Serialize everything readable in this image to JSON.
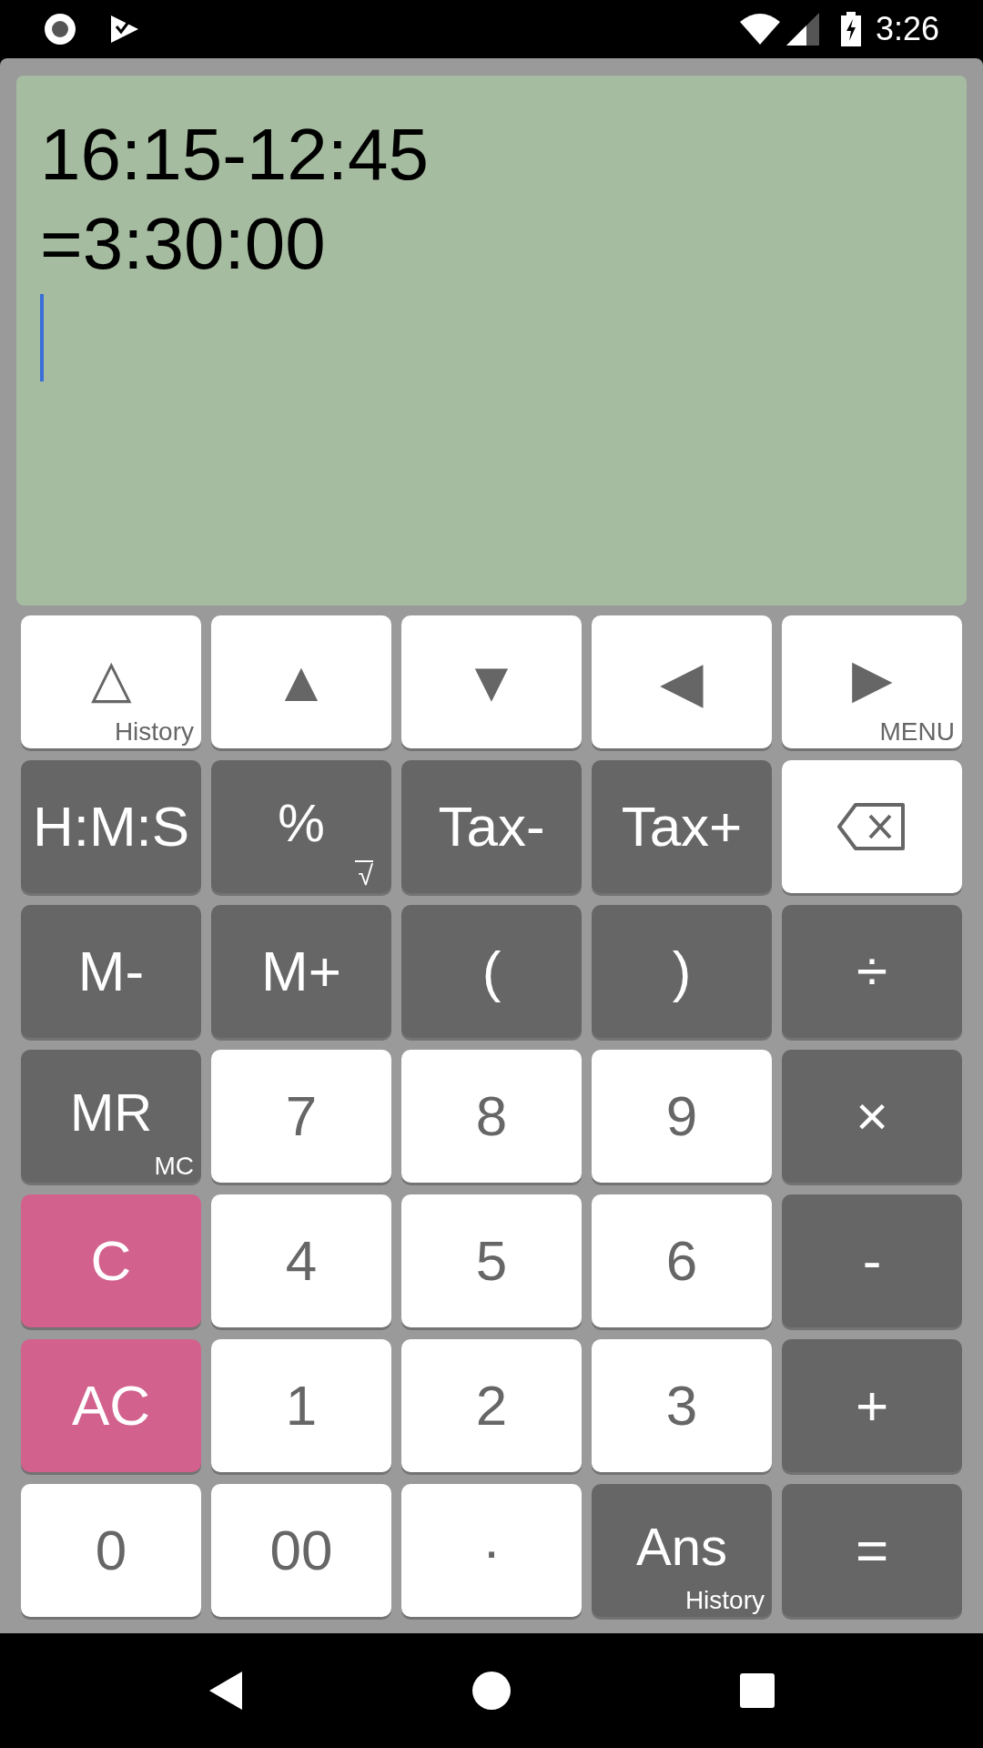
{
  "status_bar": {
    "time": "3:26"
  },
  "display": {
    "lines": [
      "16:15-12:45",
      "=3:30:00"
    ],
    "cursor": true
  },
  "keys": [
    {
      "label": "△",
      "sub": "History",
      "kind": "light"
    },
    {
      "label": "▲",
      "kind": "light"
    },
    {
      "label": "▼",
      "kind": "light"
    },
    {
      "label": "◀",
      "kind": "light"
    },
    {
      "label": "▶",
      "sub": "MENU",
      "kind": "light"
    },
    {
      "label": "H:M:S",
      "kind": "dark"
    },
    {
      "label": "%",
      "sub": "√",
      "kind": "dark"
    },
    {
      "label": "Tax-",
      "kind": "dark"
    },
    {
      "label": "Tax+",
      "kind": "dark"
    },
    {
      "kind": "backspace"
    },
    {
      "label": "M-",
      "kind": "dark"
    },
    {
      "label": "M+",
      "kind": "dark"
    },
    {
      "label": "(",
      "kind": "dark"
    },
    {
      "label": ")",
      "kind": "dark"
    },
    {
      "label": "÷",
      "kind": "dark"
    },
    {
      "label": "MR",
      "sub": "MC",
      "kind": "dark"
    },
    {
      "label": "7",
      "kind": "light"
    },
    {
      "label": "8",
      "kind": "light"
    },
    {
      "label": "9",
      "kind": "light"
    },
    {
      "label": "×",
      "kind": "dark"
    },
    {
      "label": "C",
      "kind": "pink"
    },
    {
      "label": "4",
      "kind": "light"
    },
    {
      "label": "5",
      "kind": "light"
    },
    {
      "label": "6",
      "kind": "light"
    },
    {
      "label": "-",
      "kind": "dark"
    },
    {
      "label": "AC",
      "kind": "pink"
    },
    {
      "label": "1",
      "kind": "light"
    },
    {
      "label": "2",
      "kind": "light"
    },
    {
      "label": "3",
      "kind": "light"
    },
    {
      "label": "+",
      "kind": "dark"
    },
    {
      "label": "0",
      "kind": "light"
    },
    {
      "label": "00",
      "kind": "light"
    },
    {
      "label": "·",
      "kind": "light"
    },
    {
      "label": "Ans",
      "sub": "History",
      "kind": "dark"
    },
    {
      "label": "=",
      "kind": "dark"
    }
  ]
}
